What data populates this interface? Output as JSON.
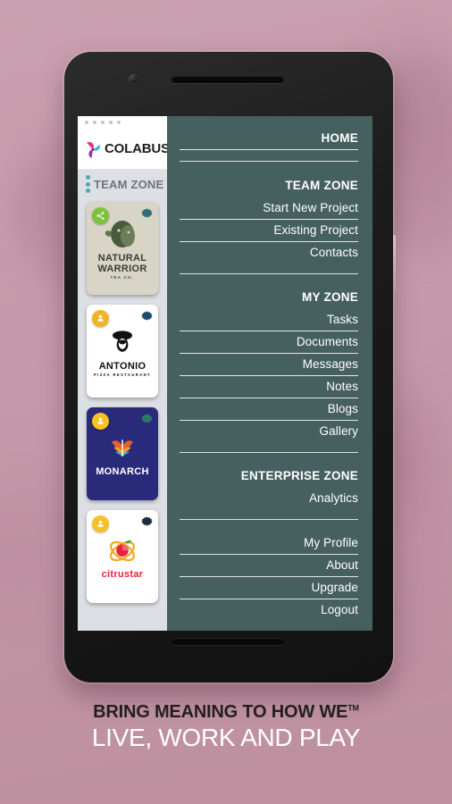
{
  "background": {
    "color": "#c49aaa"
  },
  "phone": {
    "camera_icon": "camera-dot-icon",
    "speaker_icon": "speaker-grille-icon",
    "home_bar_icon": "home-bar-icon",
    "side_button_icon": "power-button-icon"
  },
  "app": {
    "status_bar": {
      "dots": 5
    },
    "brand": {
      "wordmark": "COLABUS",
      "logo_icon": "colabus-pinwheel-icon",
      "logo_colors": [
        "#e8308a",
        "#8e3ca8",
        "#2fb6e0",
        "#a4247a"
      ]
    },
    "section_header": {
      "label": "TEAM ZONE",
      "grip_icon": "drag-grip-dots-icon",
      "grip_color": "#4fa8a8"
    },
    "project_cards": [
      {
        "name": "NATURAL WARRIOR",
        "subtitle": "TEA CO.",
        "badge_icon": "share-icon",
        "badge_color": "#7ec23b",
        "gear_icon": "gear-icon",
        "gear_color": "#2f6d7a",
        "bg_color": "#d8d4c6",
        "text_color": "#39402f"
      },
      {
        "name": "ANTONIO",
        "subtitle": "PIZZA RESTAURANT",
        "badge_icon": "user-icon",
        "badge_color": "#f0b429",
        "gear_icon": "gear-icon",
        "gear_color": "#1b4c72",
        "bg_color": "#ffffff",
        "text_color": "#111111"
      },
      {
        "name": "MONARCH",
        "subtitle": "",
        "badge_icon": "user-icon",
        "badge_color": "#f5c325",
        "gear_icon": "gear-icon",
        "gear_color": "#2b7a68",
        "bg_color": "#2a2a7a",
        "text_color": "#ffffff"
      },
      {
        "name": "citrustar",
        "subtitle": "",
        "badge_icon": "user-icon",
        "badge_color": "#f5c325",
        "gear_icon": "gear-icon",
        "gear_color": "#1d2d3d",
        "bg_color": "#ffffff",
        "text_color": "#e8213f"
      }
    ]
  },
  "drawer": {
    "background_color": "#46605f",
    "groups": [
      {
        "items": [
          {
            "label": "HOME",
            "heading": true,
            "rule": true
          }
        ]
      },
      {
        "items": [
          {
            "label": "TEAM ZONE",
            "heading": true,
            "rule": false
          },
          {
            "label": "Start New Project",
            "heading": false,
            "rule": true
          },
          {
            "label": "Existing Project",
            "heading": false,
            "rule": true
          },
          {
            "label": "Contacts",
            "heading": false,
            "rule": false
          }
        ]
      },
      {
        "items": [
          {
            "label": "MY ZONE",
            "heading": true,
            "rule": false
          },
          {
            "label": "Tasks",
            "heading": false,
            "rule": true
          },
          {
            "label": "Documents",
            "heading": false,
            "rule": true
          },
          {
            "label": "Messages",
            "heading": false,
            "rule": true
          },
          {
            "label": "Notes",
            "heading": false,
            "rule": true
          },
          {
            "label": "Blogs",
            "heading": false,
            "rule": true
          },
          {
            "label": "Gallery",
            "heading": false,
            "rule": false
          }
        ]
      },
      {
        "items": [
          {
            "label": "ENTERPRISE ZONE",
            "heading": true,
            "rule": false
          },
          {
            "label": "Analytics",
            "heading": false,
            "rule": false
          }
        ]
      },
      {
        "items": [
          {
            "label": "My Profile",
            "heading": false,
            "rule": true
          },
          {
            "label": "About",
            "heading": false,
            "rule": true
          },
          {
            "label": "Upgrade",
            "heading": false,
            "rule": true
          },
          {
            "label": "Logout",
            "heading": false,
            "rule": false
          }
        ]
      }
    ]
  },
  "tagline": {
    "line1": "BRING MEANING TO HOW WE",
    "trademark": "TM",
    "line2": "LIVE, WORK AND PLAY"
  }
}
